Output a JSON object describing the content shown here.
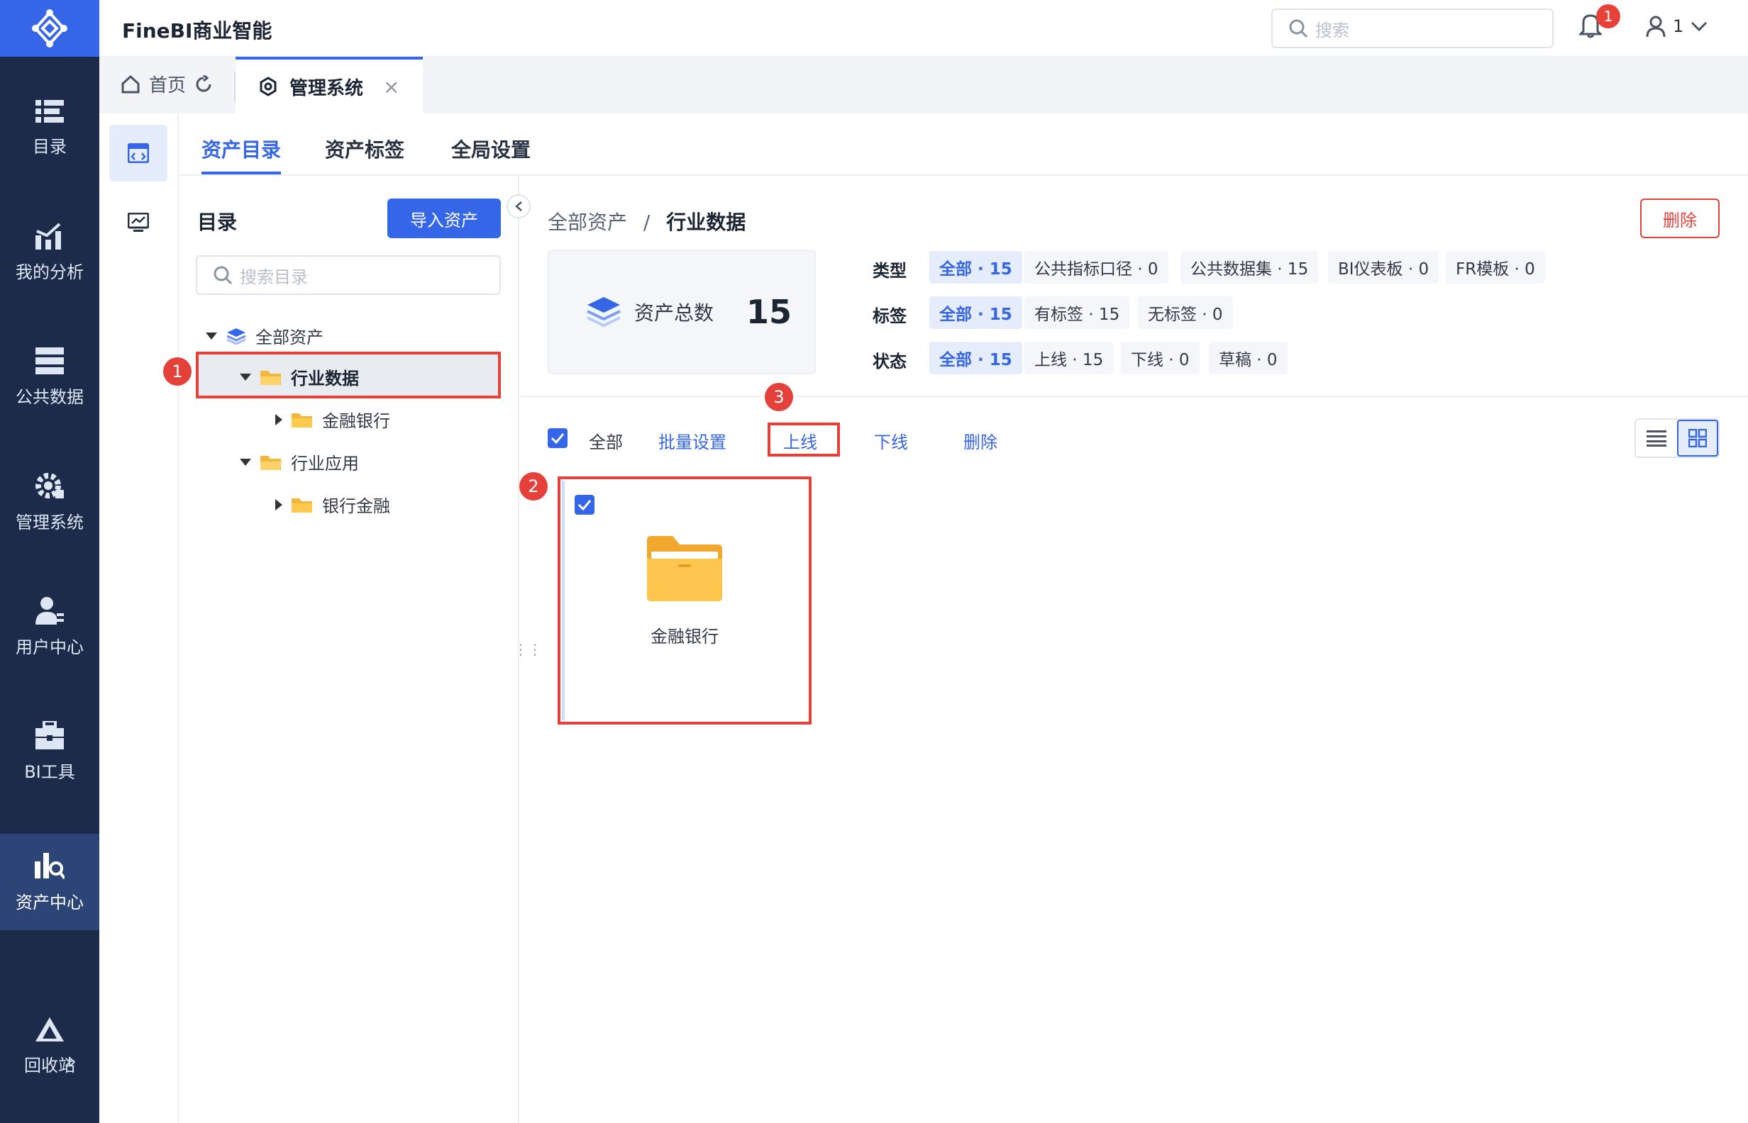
{
  "app": {
    "title": "FineBI商业智能"
  },
  "header": {
    "search_placeholder": "搜索",
    "notifications": "1",
    "user": "1"
  },
  "nav": {
    "items": [
      {
        "label": "目录",
        "icon": "catalog-icon"
      },
      {
        "label": "我的分析",
        "icon": "analysis-icon"
      },
      {
        "label": "公共数据",
        "icon": "public-data-icon"
      },
      {
        "label": "管理系统",
        "icon": "management-icon"
      },
      {
        "label": "用户中心",
        "icon": "user-center-icon"
      },
      {
        "label": "BI工具",
        "icon": "bi-tool-icon"
      },
      {
        "label": "资产中心",
        "icon": "asset-center-icon",
        "active": true
      },
      {
        "label": "回收站",
        "icon": "recycle-bin-icon"
      }
    ],
    "expand_symbol": "»"
  },
  "tabs": {
    "home": "首页",
    "active": "管理系统"
  },
  "page_tabs": [
    "资产目录",
    "资产标签",
    "全局设置"
  ],
  "directory": {
    "title": "目录",
    "import_button": "导入资产",
    "search_placeholder": "搜索目录",
    "tree": {
      "root": "全部资产",
      "industry_data": "行业数据",
      "finance_bank": "金融银行",
      "industry_app": "行业应用",
      "bank_finance": "银行金融"
    }
  },
  "content": {
    "breadcrumb_root": "全部资产",
    "breadcrumb_sep": "/",
    "breadcrumb_current": "行业数据",
    "delete_button": "删除",
    "total_label": "资产总数",
    "total_value": "15",
    "filters": {
      "type_label": "类型",
      "type_chips": [
        "全部 · 15",
        "公共指标口径 · 0",
        "公共数据集 · 15",
        "BI仪表板 · 0",
        "FR模板 · 0"
      ],
      "tag_label": "标签",
      "tag_chips": [
        "全部 · 15",
        "有标签 · 15",
        "无标签 · 0"
      ],
      "status_label": "状态",
      "status_chips": [
        "全部 · 15",
        "上线 · 15",
        "下线 · 0",
        "草稿 · 0"
      ]
    },
    "actions": {
      "select_all": "全部",
      "batch": "批量设置",
      "online": "上线",
      "offline": "下线",
      "delete": "删除"
    },
    "card": {
      "name": "金融银行"
    }
  },
  "markers": [
    "1",
    "2",
    "3"
  ],
  "colors": {
    "accent": "#3566e8",
    "nav_bg": "#1c2b4a",
    "highlight": "#e4413b",
    "folder": "#f5b73b"
  }
}
